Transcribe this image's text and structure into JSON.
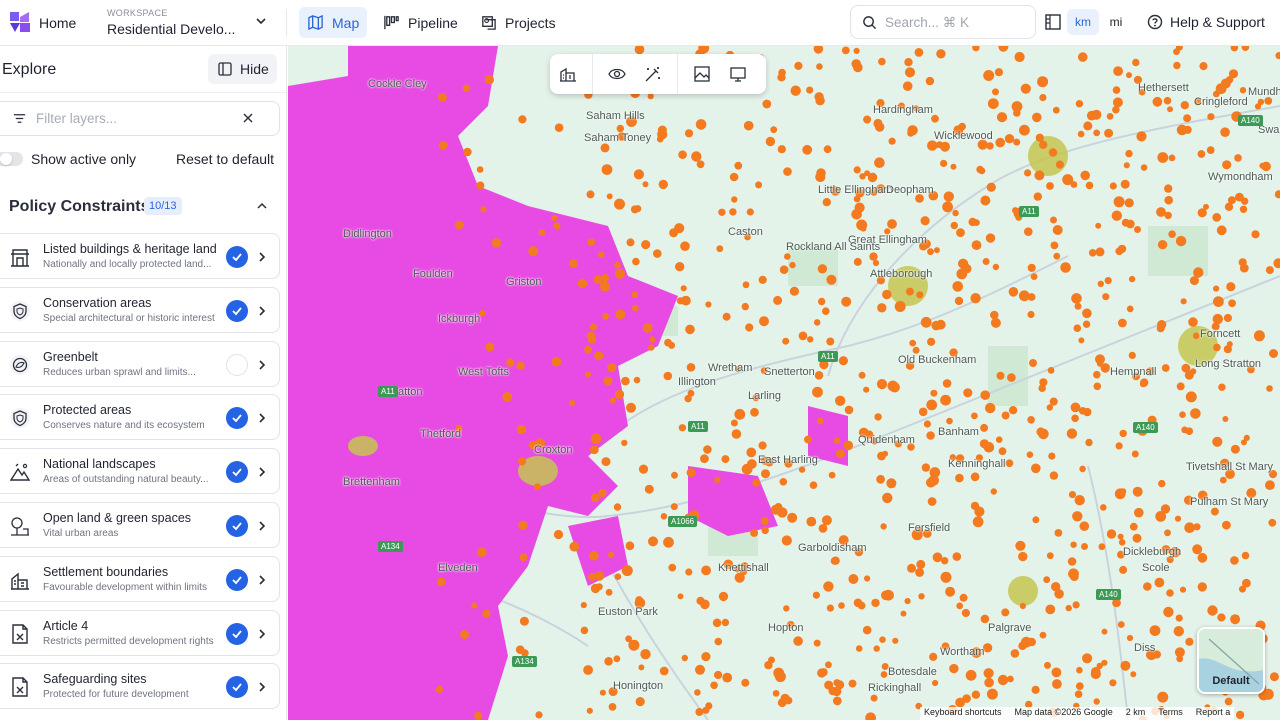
{
  "header": {
    "home_label": "Home",
    "workspace_caption": "WORKSPACE",
    "workspace_name": "Residential Develo...",
    "nav": [
      {
        "label": "Map",
        "icon": "map-icon",
        "active": true
      },
      {
        "label": "Pipeline",
        "icon": "pipeline-icon",
        "active": false
      },
      {
        "label": "Projects",
        "icon": "projects-icon",
        "active": false
      }
    ],
    "search_placeholder": "Search... ⌘ K",
    "units": [
      {
        "label": "km",
        "active": true
      },
      {
        "label": "mi",
        "active": false
      }
    ],
    "help_label": "Help & Support"
  },
  "sidebar": {
    "title": "Explore",
    "hide_label": "Hide",
    "filter_placeholder": "Filter layers...",
    "toggle_label": "Show active only",
    "toggle_on": false,
    "reset_label": "Reset to default",
    "section": {
      "title": "Policy Constraints",
      "badge": "10/13",
      "expanded": true
    },
    "layers": [
      {
        "name": "Listed buildings & heritage land",
        "desc": "Nationally and locally protected land...",
        "icon": "heritage-building-icon",
        "checked": true
      },
      {
        "name": "Conservation areas",
        "desc": "Special architectural or historic interest",
        "icon": "shield-icon",
        "checked": true
      },
      {
        "name": "Greenbelt",
        "desc": "Reduces urban sprawl and limits...",
        "icon": "greenbelt-icon",
        "checked": false
      },
      {
        "name": "Protected areas",
        "desc": "Conserves nature and its ecosystem",
        "icon": "shield-icon",
        "checked": true
      },
      {
        "name": "National landscapes",
        "desc": "Areas of outstanding natural beauty...",
        "icon": "mountain-icon",
        "checked": true
      },
      {
        "name": "Open land & green spaces",
        "desc": "Vital urban areas",
        "icon": "park-icon",
        "checked": true
      },
      {
        "name": "Settlement boundaries",
        "desc": "Favourable development within limits",
        "icon": "settlement-icon",
        "checked": true
      },
      {
        "name": "Article 4",
        "desc": "Restricts permitted development rights",
        "icon": "document-x-icon",
        "checked": true
      },
      {
        "name": "Safeguarding sites",
        "desc": "Protected for future development",
        "icon": "document-x-icon",
        "checked": true
      }
    ]
  },
  "map": {
    "colors": {
      "base": "#e4f3ea",
      "constraint_pink": "#e84be3",
      "points_orange": "#f47a20",
      "settlement_olive": "#c4c450"
    },
    "labels": [
      "Cockle Cley",
      "Saham Hills",
      "Saham Toney",
      "Hardingham",
      "Wicklewood",
      "Hethersett",
      "Cringleford",
      "Swardeston",
      "Little Ellingham",
      "Great Ellingham",
      "Deopham",
      "Rockland All Saints",
      "Attleborough",
      "Didlington",
      "Foulden",
      "Ickburgh",
      "West Tofts",
      "Watton",
      "Griston",
      "Caston",
      "Wretham",
      "Illington",
      "Snetterton",
      "Larling",
      "Old Buckenham",
      "Quidenham",
      "Banham",
      "Kenninghall",
      "Croxton",
      "Thetford",
      "Brettenham",
      "East Harling",
      "Garboldisham",
      "Knettishall",
      "Fersfield",
      "Elveden",
      "Euston Park",
      "Hopton",
      "Palgrave",
      "Wortham",
      "Diss",
      "Tivetshall St Mary",
      "Pulham St Mary",
      "Long Stratton",
      "Forncett",
      "Hempnall",
      "Dickleburgh",
      "Scole",
      "Botesdale",
      "Rickinghall",
      "Honington",
      "Mundham",
      "Wymondham"
    ],
    "roads": [
      "A11",
      "A11",
      "A11",
      "A1066",
      "A11",
      "A140",
      "A140",
      "A140",
      "A134",
      "A134"
    ],
    "toolbar": [
      "buildings-icon",
      "eye-icon",
      "magic-wand-icon",
      "image-icon",
      "monitor-icon"
    ],
    "basemap_label": "Default",
    "attribution": [
      "Keyboard shortcuts",
      "Map data ©2026 Google",
      "2 km",
      "Terms",
      "Report a"
    ]
  }
}
